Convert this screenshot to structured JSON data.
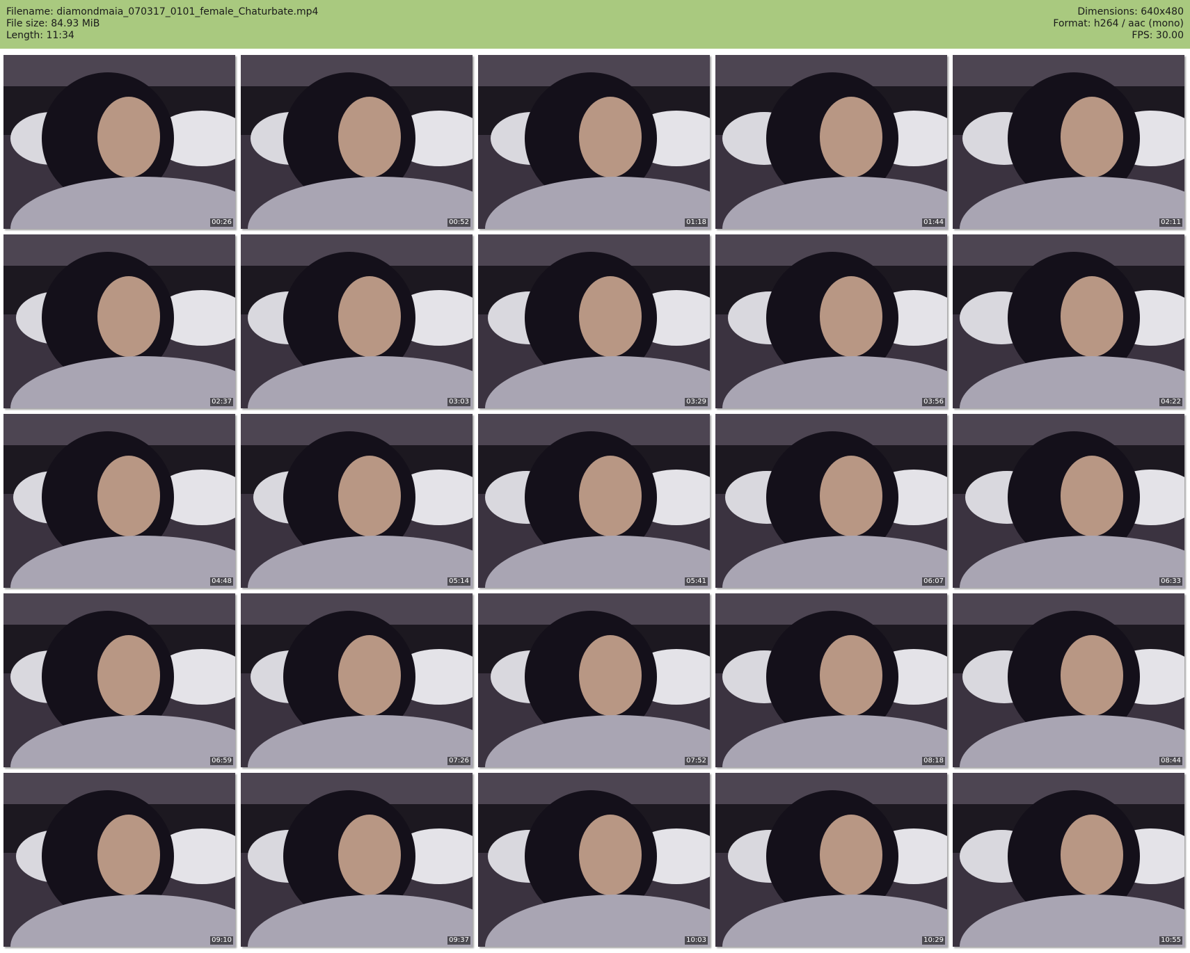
{
  "header": {
    "filename": "Filename: diamondmaia_070317_0101_female_Chaturbate.mp4",
    "filesize": "File size: 84.93 MiB",
    "length": "Length: 11:34",
    "dimensions": "Dimensions: 640x480",
    "format": "Format: h264 / aac (mono)",
    "fps": "FPS: 30.00"
  },
  "thumbnails": [
    {
      "timestamp": "00:26"
    },
    {
      "timestamp": "00:52"
    },
    {
      "timestamp": "01:18"
    },
    {
      "timestamp": "01:44"
    },
    {
      "timestamp": "02:11"
    },
    {
      "timestamp": "02:37"
    },
    {
      "timestamp": "03:03"
    },
    {
      "timestamp": "03:29"
    },
    {
      "timestamp": "03:56"
    },
    {
      "timestamp": "04:22"
    },
    {
      "timestamp": "04:48"
    },
    {
      "timestamp": "05:14"
    },
    {
      "timestamp": "05:41"
    },
    {
      "timestamp": "06:07"
    },
    {
      "timestamp": "06:33"
    },
    {
      "timestamp": "06:59"
    },
    {
      "timestamp": "07:26"
    },
    {
      "timestamp": "07:52"
    },
    {
      "timestamp": "08:18"
    },
    {
      "timestamp": "08:44"
    },
    {
      "timestamp": "09:10"
    },
    {
      "timestamp": "09:37"
    },
    {
      "timestamp": "10:03"
    },
    {
      "timestamp": "10:29"
    },
    {
      "timestamp": "10:55"
    }
  ],
  "colors": {
    "header_bg": "#a9c97f",
    "timestamp_bg": "#000000"
  }
}
